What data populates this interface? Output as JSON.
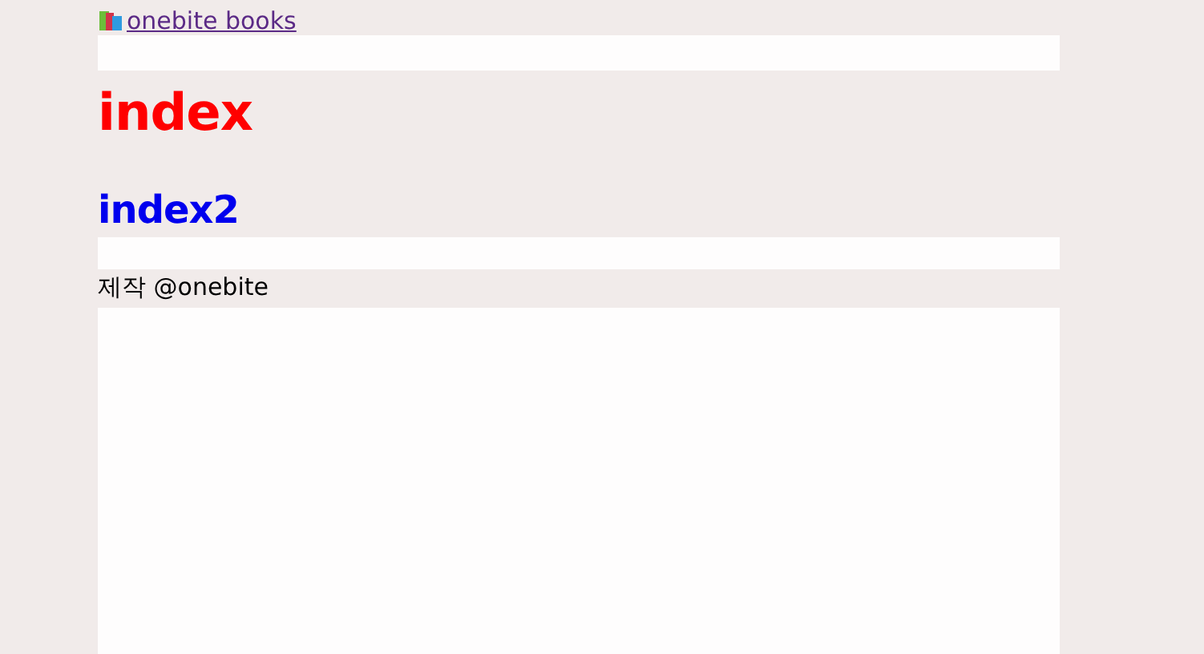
{
  "header": {
    "link": "onebite books"
  },
  "main": {
    "heading": "index",
    "subheading": "index2"
  },
  "footer": {
    "text": "제작 @onebite"
  }
}
